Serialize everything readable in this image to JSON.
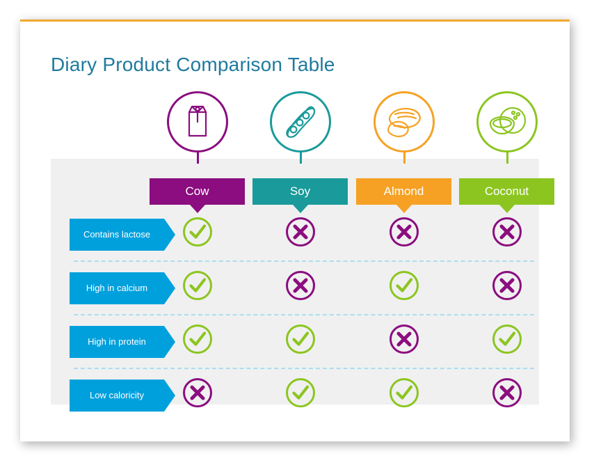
{
  "slide": {
    "title": "Diary Product Comparison Table",
    "accent_color": "#f0a830",
    "background_color": "#ffffff",
    "panel_color": "#f0f0f0",
    "title_color": "#1f7a9e"
  },
  "columns": [
    {
      "label": "Cow",
      "color": "#8b0d7f",
      "icon": "milk-carton-icon"
    },
    {
      "label": "Soy",
      "color": "#1a9a9a",
      "icon": "soy-pod-icon"
    },
    {
      "label": "Almond",
      "color": "#f6a124",
      "icon": "almond-icon"
    },
    {
      "label": "Coconut",
      "color": "#8cc520",
      "icon": "coconut-icon"
    }
  ],
  "rows": [
    {
      "label": "Contains lactose",
      "color": "#00a0dd"
    },
    {
      "label": "High in calcium",
      "color": "#00a0dd"
    },
    {
      "label": "High in protein",
      "color": "#00a0dd"
    },
    {
      "label": "Low caloricity",
      "color": "#00a0dd"
    }
  ],
  "marks": {
    "yes_color": "#8cc520",
    "no_color": "#8b0d7f",
    "yes_name": "check-circle-icon",
    "no_name": "cross-circle-icon"
  },
  "chart_data": {
    "type": "table",
    "title": "Diary Product Comparison Table",
    "categories": [
      "Cow",
      "Soy",
      "Almond",
      "Coconut"
    ],
    "row_labels": [
      "Contains lactose",
      "High in calcium",
      "High in protein",
      "Low caloricity"
    ],
    "values": [
      [
        "yes",
        "no",
        "no",
        "no"
      ],
      [
        "yes",
        "no",
        "yes",
        "no"
      ],
      [
        "yes",
        "yes",
        "no",
        "yes"
      ],
      [
        "no",
        "yes",
        "yes",
        "no"
      ]
    ],
    "legend": {
      "yes": "check mark (green)",
      "no": "cross mark (purple)"
    }
  }
}
